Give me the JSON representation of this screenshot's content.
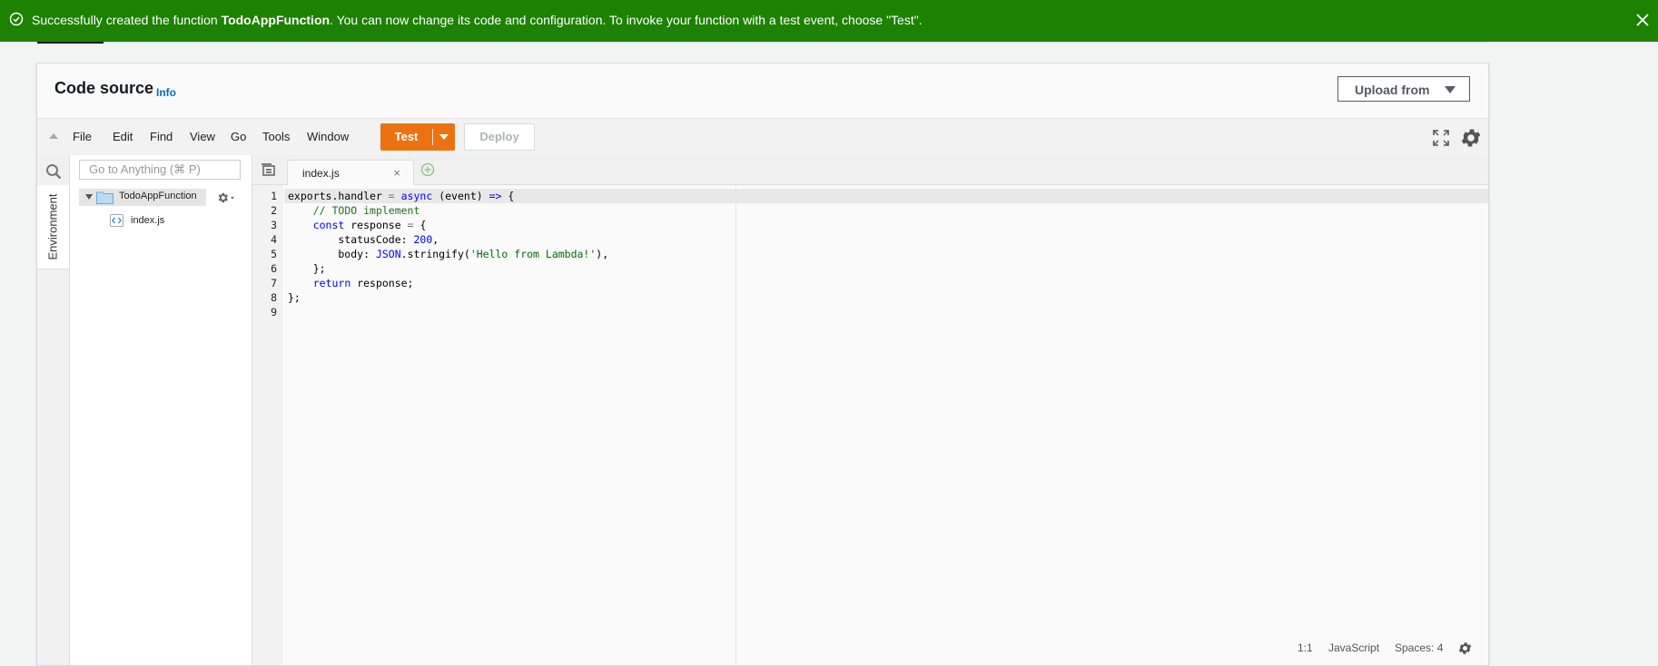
{
  "flash": {
    "message_prefix": "Successfully created the function ",
    "function_name": "TodoAppFunction",
    "message_suffix": ". You can now change its code and configuration. To invoke your function with a test event, choose \"Test\"."
  },
  "panel": {
    "title": "Code source",
    "info_link": "Info",
    "upload_label": "Upload from"
  },
  "toolbar": {
    "menus": [
      "File",
      "Edit",
      "Find",
      "View",
      "Go",
      "Tools",
      "Window"
    ],
    "test_label": "Test",
    "deploy_label": "Deploy"
  },
  "sidebar": {
    "environment_label": "Environment",
    "goto_placeholder": "Go to Anything (⌘ P)",
    "folder_name": "TodoAppFunction",
    "file_name": "index.js"
  },
  "editor": {
    "tab_label": "index.js",
    "line_numbers": [
      "1",
      "2",
      "3",
      "4",
      "5",
      "6",
      "7",
      "8",
      "9"
    ],
    "code_lines": [
      "exports.handler = async (event) => {",
      "    // TODO implement",
      "    const response = {",
      "        statusCode: 200,",
      "        body: JSON.stringify('Hello from Lambda!'),",
      "    };",
      "    return response;",
      "};",
      ""
    ]
  },
  "status_bar": {
    "cursor": "1:1",
    "language": "JavaScript",
    "spaces": "Spaces: 4"
  },
  "colors": {
    "flash_success": "#1d8102",
    "test_button": "#ec7211",
    "info_link": "#0073bb"
  }
}
